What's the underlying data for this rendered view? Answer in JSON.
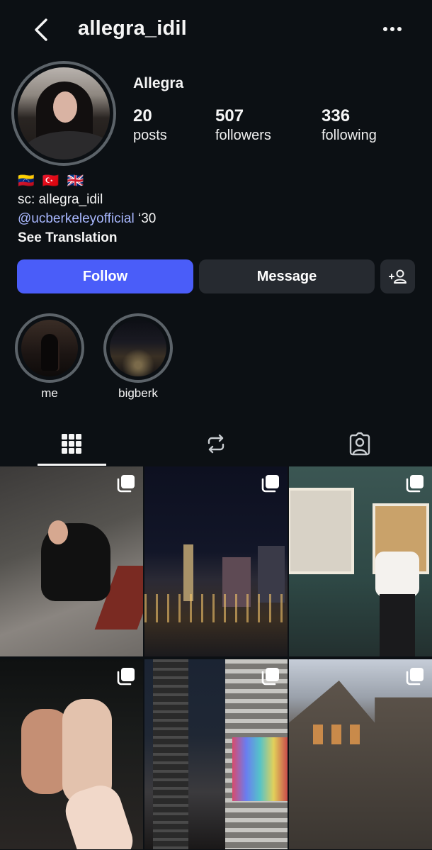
{
  "header": {
    "username": "allegra_idil"
  },
  "profile": {
    "display_name": "Allegra",
    "stats": [
      {
        "value": "20",
        "label": "posts"
      },
      {
        "value": "507",
        "label": "followers"
      },
      {
        "value": "336",
        "label": "following"
      }
    ],
    "flags": "🇻🇪 🇹🇷 🇬🇧",
    "bio_line_1": "sc: allegra_idil",
    "bio_mention": "@ucberkeleyofficial",
    "bio_mention_suffix": " ‘30",
    "see_translation": "See Translation"
  },
  "actions": {
    "follow": "Follow",
    "message": "Message"
  },
  "highlights": [
    {
      "label": "me"
    },
    {
      "label": "bigberk"
    }
  ],
  "tabs": [
    {
      "icon": "grid-icon",
      "active": true
    },
    {
      "icon": "reposts-icon",
      "active": false
    },
    {
      "icon": "tagged-icon",
      "active": false
    }
  ],
  "colors": {
    "background": "#0c1014",
    "follow_button": "#4a5df9",
    "secondary_button": "#262a30",
    "mention": "#a9b8ff"
  }
}
